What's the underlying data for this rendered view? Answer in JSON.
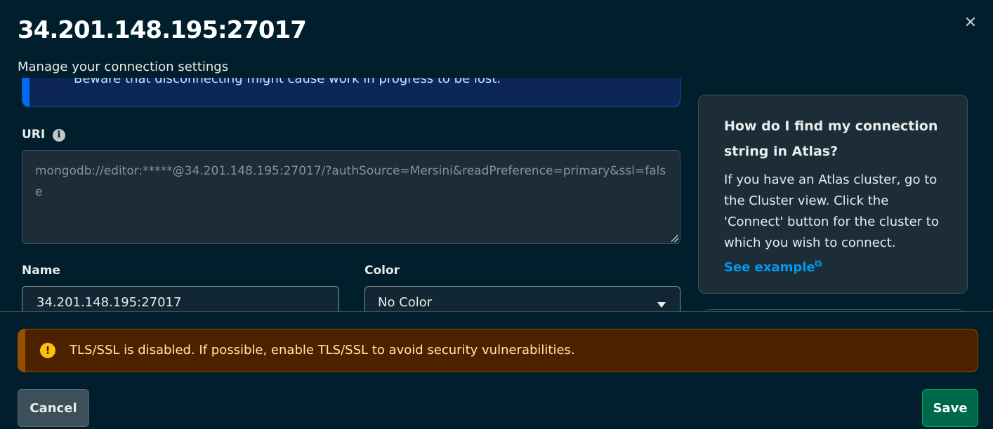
{
  "modal": {
    "title": "34.201.148.195:27017",
    "subtitle": "Manage your connection settings",
    "close_icon": "close-icon"
  },
  "info_banner": {
    "text": "Beware that disconnecting might cause work in progress to be lost.",
    "color": "#016bf8"
  },
  "uri": {
    "label": "URI",
    "info_icon": "info-icon",
    "value": "mongodb://editor:*****@34.201.148.195:27017/?authSource=Mersini&readPreference=primary&ssl=false"
  },
  "name": {
    "label": "Name",
    "value": "34.201.148.195:27017"
  },
  "color": {
    "label": "Color",
    "selected": "No Color"
  },
  "help": {
    "title": "How do I find my connection string in Atlas?",
    "body": "If you have an Atlas cluster, go to the Cluster view. Click the 'Connect' button for the cluster to which you wish to connect.",
    "link": "See example",
    "link_color": "#0498ec"
  },
  "warning": {
    "text": "TLS/SSL is disabled. If possible, enable TLS/SSL to avoid security vulnerabilities.",
    "icon": "warning-icon",
    "color": "#ffc010"
  },
  "footer": {
    "cancel_label": "Cancel",
    "save_label": "Save",
    "save_color": "#00684a"
  }
}
